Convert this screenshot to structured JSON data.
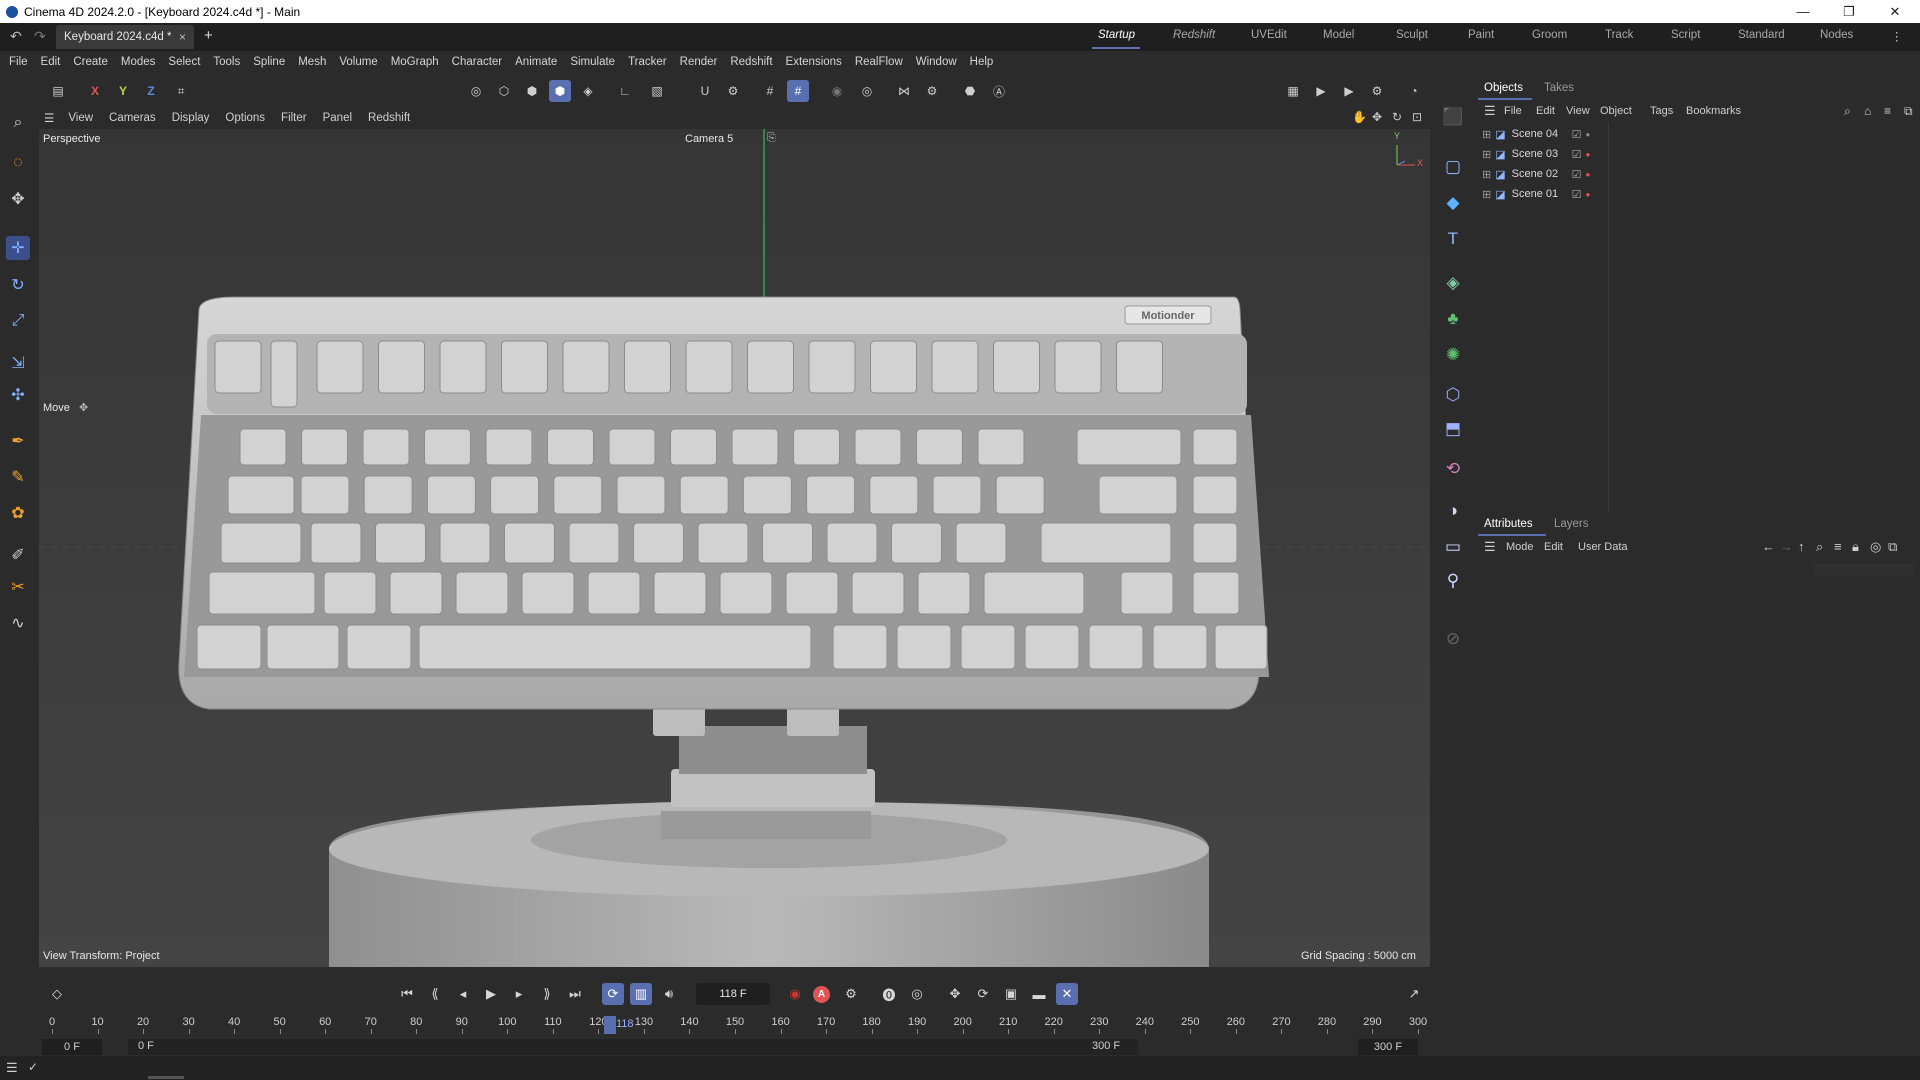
{
  "window": {
    "title": "Cinema 4D 2024.2.0 - [Keyboard 2024.c4d *] - Main",
    "minimize_glyph": "—",
    "maximize_glyph": "❐",
    "close_glyph": "✕"
  },
  "tabs": {
    "document": "Keyboard 2024.c4d *",
    "close_glyph": "×",
    "add_glyph": "+",
    "layouts": [
      "Startup",
      "Redshift",
      "UVEdit",
      "Model",
      "Sculpt",
      "Paint",
      "Groom",
      "Track",
      "Script",
      "Standard",
      "Nodes"
    ],
    "more_glyph": "⋮"
  },
  "menu": [
    "File",
    "Edit",
    "Create",
    "Modes",
    "Select",
    "Tools",
    "Spline",
    "Mesh",
    "Volume",
    "MoGraph",
    "Character",
    "Animate",
    "Simulate",
    "Tracker",
    "Render",
    "Redshift",
    "Extensions",
    "RealFlow",
    "Window",
    "Help"
  ],
  "toolbar": {
    "x_axis": "X",
    "y_axis": "Y",
    "z_axis": "Z",
    "axis_colors": {
      "x": "#e05454",
      "y": "#b8d24a",
      "z": "#5a8ee0"
    }
  },
  "viewport": {
    "menu": [
      "View",
      "Cameras",
      "Display",
      "Options",
      "Filter",
      "Panel",
      "Redshift"
    ],
    "projection": "Perspective",
    "camera": "Camera 5",
    "active_tool": "Move",
    "view_transform": "View Transform: Project",
    "grid_spacing": "Grid Spacing : 5000 cm",
    "keyboard_brand": "Motionder",
    "axis_y": "Y",
    "axis_x": "X"
  },
  "objects_panel": {
    "tabs": [
      "Objects",
      "Takes"
    ],
    "menu": [
      "File",
      "Edit",
      "View",
      "Object",
      "Tags",
      "Bookmarks"
    ],
    "items": [
      "Scene 04",
      "Scene 03",
      "Scene 02",
      "Scene 01"
    ]
  },
  "attributes_panel": {
    "tabs": [
      "Attributes",
      "Layers"
    ],
    "menu": [
      "Mode",
      "Edit",
      "User Data"
    ]
  },
  "timeline": {
    "current_frame": "118 F",
    "playhead_label": "118",
    "ticks": [
      0,
      10,
      20,
      30,
      40,
      50,
      60,
      70,
      80,
      90,
      100,
      110,
      120,
      130,
      140,
      150,
      160,
      170,
      180,
      190,
      200,
      210,
      220,
      230,
      240,
      250,
      260,
      270,
      280,
      290,
      300
    ],
    "start": "0 F",
    "preview_start": "0 F",
    "preview_end": "300 F",
    "end": "300 F",
    "record_label": "A"
  },
  "colors": {
    "accent": "#5a6fb0",
    "viewport_bg": "#3d3d3d",
    "panel_bg": "#2b2b2b",
    "camera_line": "#3fcf6a"
  }
}
